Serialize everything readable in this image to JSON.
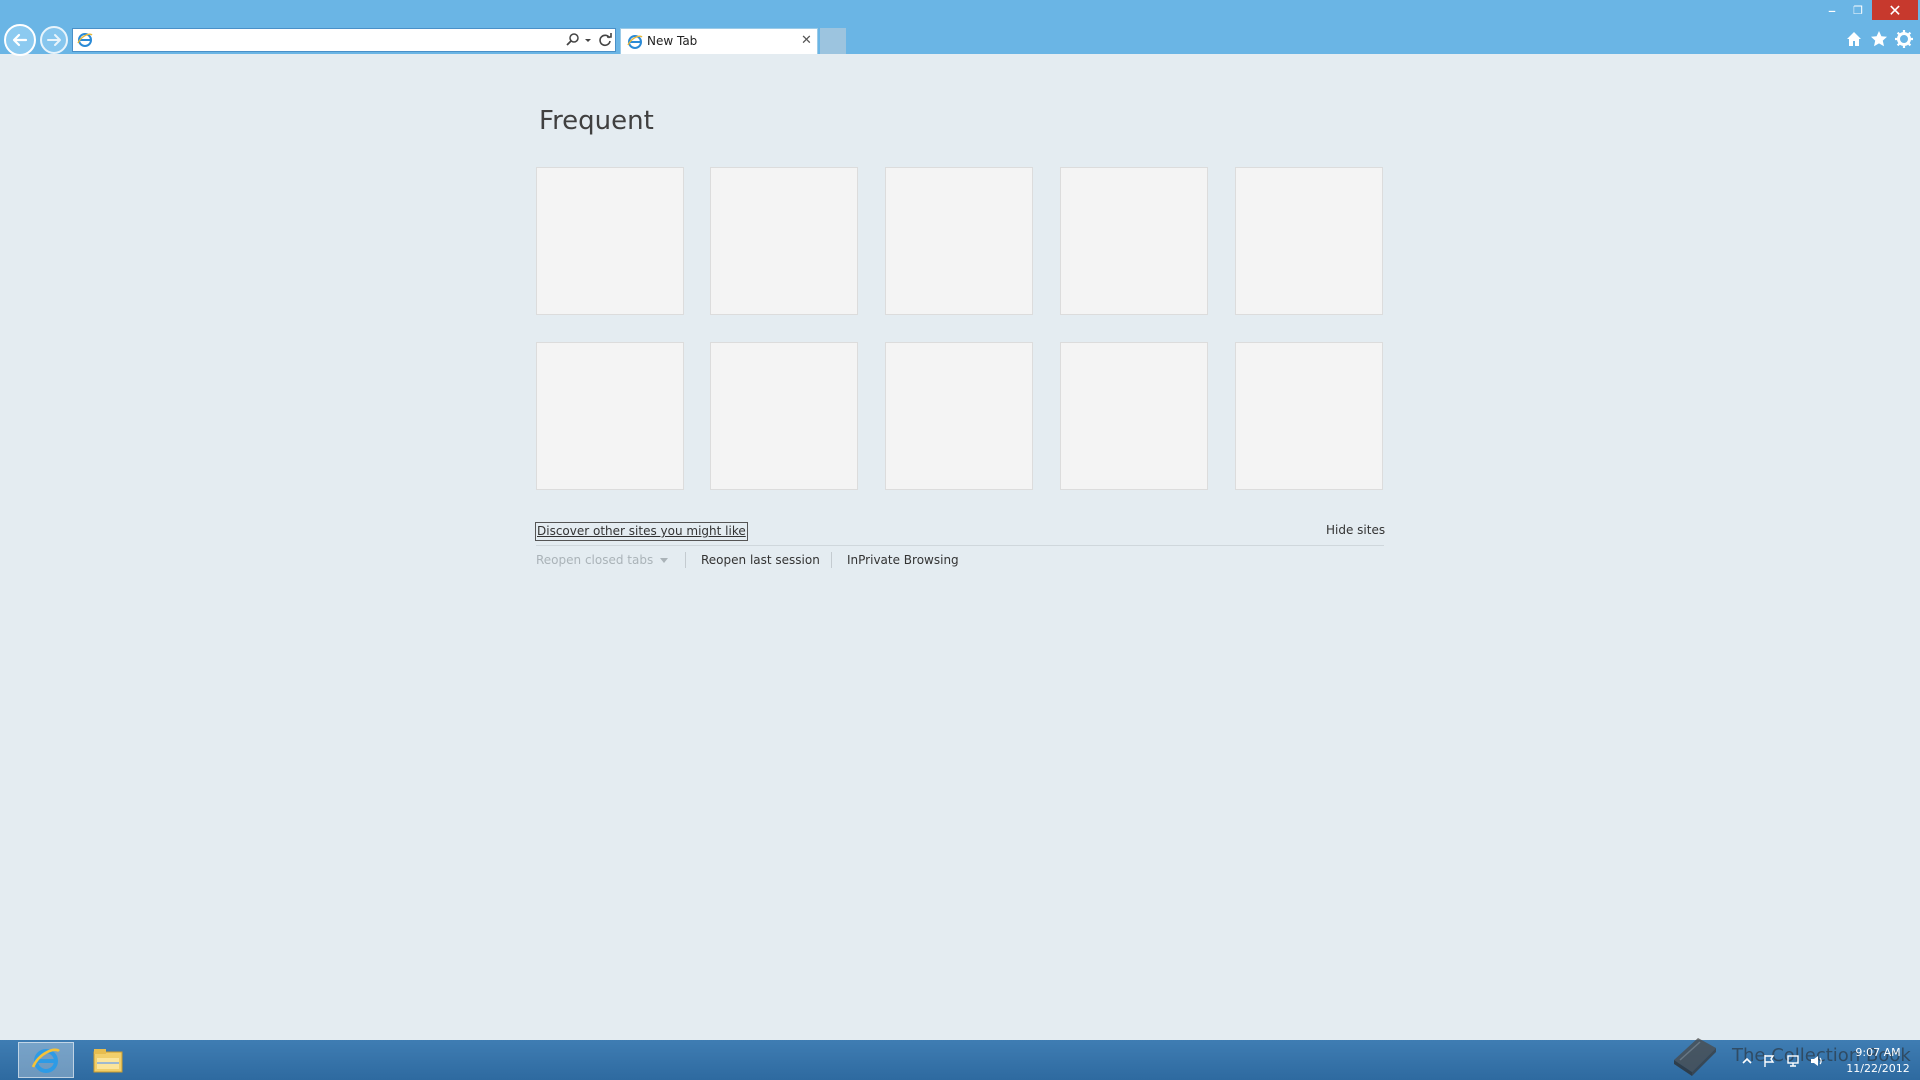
{
  "browser": {
    "address_value": "",
    "tab_title": "New Tab",
    "tab_close_glyph": "✕",
    "accent_color": "#6ab5e5",
    "icons": {
      "back": "back-arrow-icon",
      "forward": "forward-arrow-icon",
      "search": "search-icon",
      "refresh": "refresh-icon",
      "home": "home-icon",
      "favorites": "star-icon",
      "tools": "gear-icon"
    }
  },
  "window_controls": {
    "minimize_glyph": "–",
    "restore_glyph": "❐",
    "close_glyph": "✕"
  },
  "page": {
    "frequent_heading": "Frequent",
    "tiles_count_visible": 10,
    "discover_link": "Discover other sites you might like",
    "hide_sites": "Hide sites",
    "reopen_closed_tabs": "Reopen closed tabs",
    "reopen_last_session": "Reopen last session",
    "inprivate_browsing": "InPrivate Browsing"
  },
  "taskbar": {
    "pinned": [
      "internet-explorer",
      "file-explorer"
    ],
    "watermark_text": "The Collection Book",
    "clock_time": "9:07 AM",
    "clock_date": "11/22/2012"
  }
}
